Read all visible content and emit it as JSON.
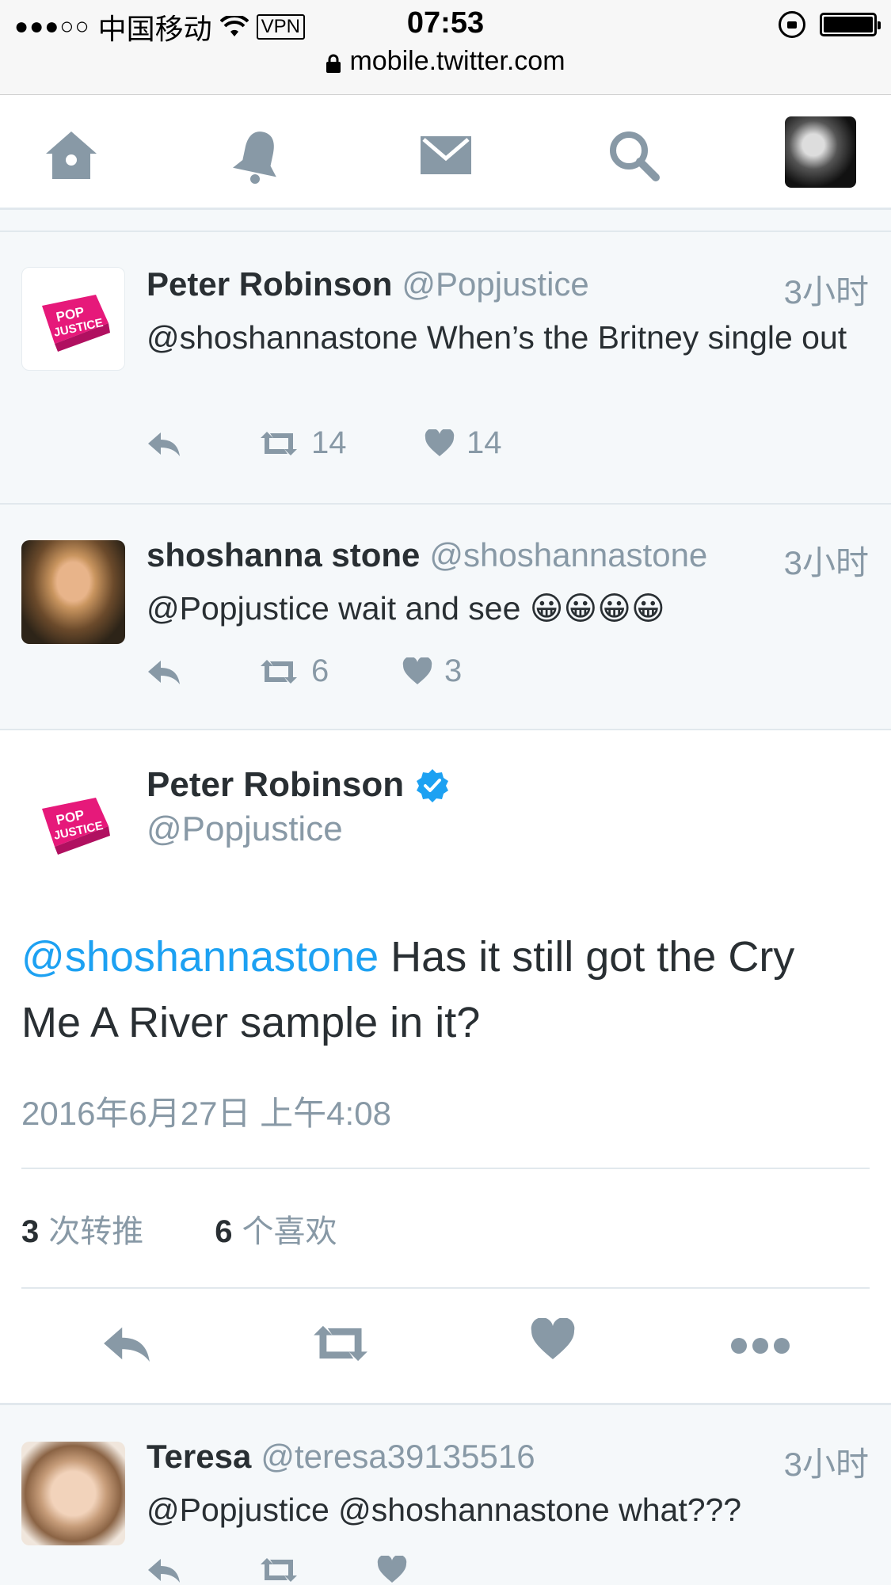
{
  "status_bar": {
    "signal": "●●●○○",
    "carrier": "中国移动",
    "vpn": "VPN",
    "time": "07:53",
    "url": "mobile.twitter.com"
  },
  "nav": {
    "icons": [
      "home-icon",
      "bell-icon",
      "mail-icon",
      "search-icon",
      "profile-avatar"
    ]
  },
  "replies_above": [
    {
      "name": "Peter Robinson",
      "handle": "@Popjustice",
      "time": "3小时",
      "text": "@shoshannastone When’s the Britney single out",
      "retweets": "14",
      "likes": "14"
    },
    {
      "name": "shoshanna stone",
      "handle": "@shoshannastone",
      "time": "3小时",
      "text": "@Popjustice wait and see 😀😀😀😀",
      "retweets": "6",
      "likes": "3"
    }
  ],
  "main_tweet": {
    "name": "Peter Robinson",
    "handle": "@Popjustice",
    "mention": "@shoshannastone",
    "text": " Has it still got the Cry Me A River sample in it?",
    "date": "2016年6月27日 上午4:08",
    "retweet_count": "3",
    "retweet_label": "次转推",
    "like_count": "6",
    "like_label": "个喜欢"
  },
  "reply_below": {
    "name": "Teresa",
    "handle": "@teresa39135516",
    "time": "3小时",
    "text": "@Popjustice @shoshannastone what???"
  },
  "colors": {
    "accent": "#1da1f2",
    "icon_gray": "#8899a6",
    "text": "#292f33",
    "brand_pink": "#e6197a"
  }
}
